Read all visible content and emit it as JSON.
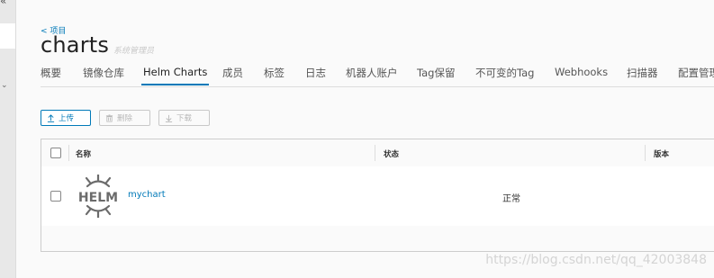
{
  "sidebar": {
    "collapse_icon": "«",
    "chevron_icon": "⌄"
  },
  "header": {
    "back_link": "< 项目",
    "title": "charts",
    "role": "系统管理员"
  },
  "tabs": [
    {
      "label": "概要"
    },
    {
      "label": "镜像仓库"
    },
    {
      "label": "Helm Charts",
      "active": true
    },
    {
      "label": "成员"
    },
    {
      "label": "标签"
    },
    {
      "label": "日志"
    },
    {
      "label": "机器人账户"
    },
    {
      "label": "Tag保留"
    },
    {
      "label": "不可变的Tag"
    },
    {
      "label": "Webhooks"
    },
    {
      "label": "扫描器"
    },
    {
      "label": "配置管理"
    }
  ],
  "toolbar": {
    "upload_label": "上传",
    "delete_label": "删除",
    "download_label": "下载"
  },
  "table": {
    "columns": {
      "name": "名称",
      "status": "状态",
      "version": "版本"
    },
    "rows": [
      {
        "name": "mychart",
        "status": "正常",
        "icon": "helm-logo",
        "logo_text": "HELM"
      }
    ]
  },
  "watermark": "https://blog.csdn.net/qq_42003848",
  "colors": {
    "accent": "#0079b8",
    "disabled": "#b8b8b8"
  }
}
